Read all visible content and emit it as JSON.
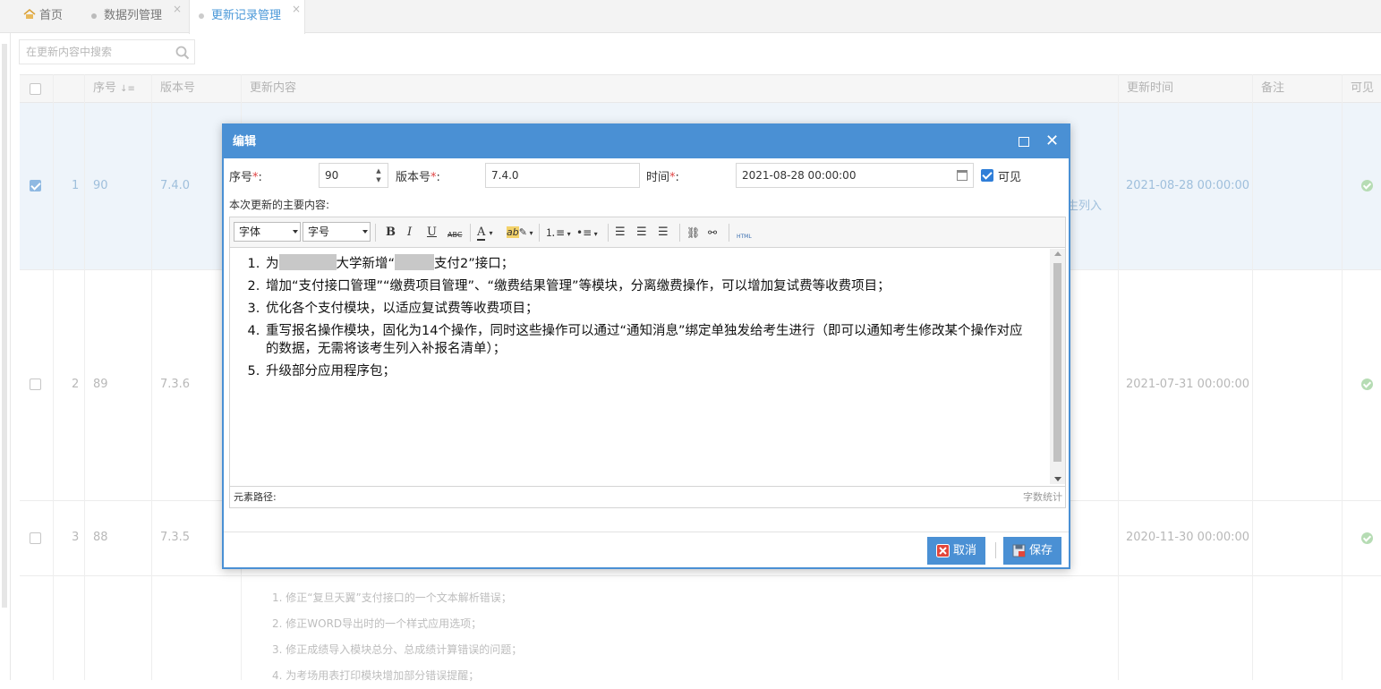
{
  "tabs": [
    {
      "label": "首页"
    },
    {
      "label": "数据列管理",
      "close": "×"
    },
    {
      "label": "更新记录管理",
      "close": "×"
    }
  ],
  "search": {
    "placeholder": "在更新内容中搜索"
  },
  "grid": {
    "headers": {
      "seq": "序号",
      "version": "版本号",
      "content": "更新内容",
      "time": "更新时间",
      "note": "备注",
      "visible": "可见"
    },
    "rows": [
      {
        "seq": "1",
        "no": "90",
        "version": "7.4.0",
        "time": "2021-08-28 00:00:00",
        "fragment": "生列入"
      },
      {
        "seq": "2",
        "no": "89",
        "version": "7.3.6",
        "time": "2021-07-31 00:00:00"
      },
      {
        "seq": "3",
        "no": "88",
        "version": "7.3.5",
        "time": "2020-11-30 00:00:00"
      }
    ],
    "row4_lines": [
      "1. 修正“复旦天翼”支付接口的一个文本解析错误；",
      "2. 修正WORD导出时的一个样式应用选项；",
      "3. 修正成绩导入模块总分、总成绩计算错误的问题；",
      "4. 为考场用表打印模块增加部分错误提醒；"
    ]
  },
  "dialog": {
    "title": "编辑",
    "seq_label": "序号",
    "seq_value": "90",
    "version_label": "版本号",
    "version_value": "7.4.0",
    "time_label": "时间",
    "time_value": "2021-08-28 00:00:00",
    "visible_label": "可见",
    "colon": ":",
    "required_mark": "*",
    "content_label": "本次更新的主要内容:",
    "toolbar": {
      "font": "字体",
      "size": "字号",
      "bold": "B",
      "italic": "I",
      "underline": "U",
      "strike": "ABC",
      "html": "HTML"
    },
    "content": {
      "item1_a": "为",
      "item1_b": "大学新增“",
      "item1_c": "支付2”接口；",
      "item2": "增加“支付接口管理”“缴费项目管理”、“缴费结果管理”等模块，分离缴费操作，可以增加复试费等收费项目；",
      "item3": "优化各个支付模块，以适应复试费等收费项目；",
      "item4": "重写报名操作模块，固化为14个操作，同时这些操作可以通过“通知消息”绑定单独发给考生进行（即可以通知考生修改某个操作对应的数据，无需将该考生列入补报名清单）；",
      "item5": "升级部分应用程序包；"
    },
    "element_path": "元素路径:",
    "word_count": "字数统计",
    "cancel": "取消",
    "save": "保存"
  },
  "colors": {
    "accent": "#4a90d4",
    "selected_row": "#eef4fa"
  }
}
